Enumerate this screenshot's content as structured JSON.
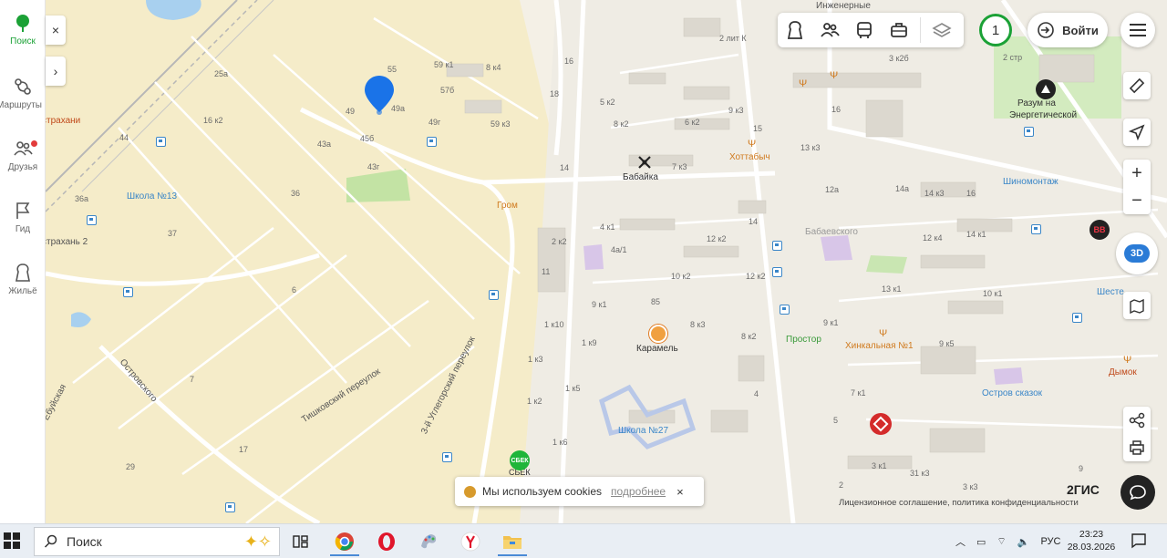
{
  "sidebar": {
    "items": [
      {
        "label": "Поиск",
        "icon": "tree-icon",
        "active": true
      },
      {
        "label": "Маршруты",
        "icon": "route-icon"
      },
      {
        "label": "Друзья",
        "icon": "friends-icon",
        "badge": true
      },
      {
        "label": "Гид",
        "icon": "guide-flag-icon"
      },
      {
        "label": "Жильё",
        "icon": "housing-icon"
      }
    ],
    "collapse_label": "×",
    "expand_label": "›"
  },
  "toolbar": {
    "icons": [
      "places-icon",
      "people-icon",
      "transport-icon",
      "briefcase-icon",
      "layers-icon"
    ]
  },
  "header": {
    "badge_count": "1",
    "login_label": "Войти"
  },
  "map": {
    "labels": {
      "inzhenernye": "Инженерные",
      "astrakhani": "страхани",
      "astrakhan2": "страхань 2",
      "school13": "Школа №13",
      "grom": "Гром",
      "babaika": "Бабайка",
      "hottabych": "Хоттабыч",
      "razum1": "Разум на",
      "razum2": "Энергетической",
      "shinomontazh": "Шиномонтаж",
      "babaevskogo": "Бабаевского",
      "shest": "Шесте",
      "prostor": "Простор",
      "hinkalnaya": "Хинкальная №1",
      "dymok": "Дымок",
      "karamel": "Карамель",
      "ostrov": "Остров сказок",
      "school27": "Школа №27",
      "tishkovsky": "Тишковский переулок",
      "uglegorsky": "3-й Углегорский переулок",
      "ostrovskogo": "Островского",
      "ebuzh": "Ебуйская",
      "sbek": "СБЕК"
    },
    "house_numbers": [
      "55",
      "59 к1",
      "8 к4",
      "16",
      "2 лит К",
      "3 к2б",
      "2 стр",
      "57б",
      "18",
      "5 к2",
      "9 к3",
      "16",
      "49",
      "49а",
      "49г",
      "45б",
      "43а",
      "43г",
      "59 к3",
      "8 к2",
      "6 к2",
      "15",
      "13 к3",
      "25а",
      "16 к2",
      "44",
      "36а",
      "36",
      "14",
      "7 к3",
      "12а",
      "14а",
      "14 к3",
      "16",
      "37",
      "4 к1",
      "14",
      "12 к2",
      "12 к4",
      "14 к1",
      "2 к2",
      "4а/1",
      "10 к2",
      "12 к2",
      "13 к1",
      "11",
      "9 к1",
      "10 к1",
      "85",
      "6",
      "1 к10",
      "8 к3",
      "8 к2",
      "9 к1",
      "9 к5",
      "1 к9",
      "1 к3",
      "7",
      "1 к2",
      "1 к5",
      "4",
      "7 к1",
      "1 к6",
      "17",
      "5",
      "29",
      "3 к1",
      "31 к3",
      "2",
      "3 к3",
      "9"
    ]
  },
  "cookie": {
    "text": "Мы используем cookies",
    "link": "подробнее",
    "close": "×"
  },
  "footer": {
    "brand": "2ГИС",
    "legal": "Лицензионное соглашение, политика конфиденциальности"
  },
  "taskbar": {
    "search_placeholder": "Поиск",
    "apps": [
      "task-view-icon",
      "chrome-icon",
      "opera-icon",
      "paint-icon",
      "yandex-icon",
      "file-explorer-icon"
    ],
    "lang": "РУС",
    "time": "23:23",
    "date": "28.03.2026"
  },
  "colors": {
    "accent_green": "#1ba136",
    "marker_blue": "#1a73e8",
    "bus_stop_blue": "#3a86c8",
    "poi_orange": "#d07a1e"
  }
}
